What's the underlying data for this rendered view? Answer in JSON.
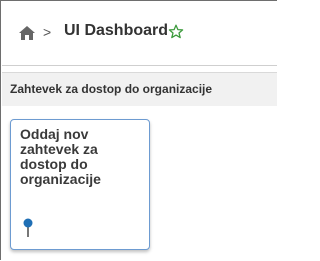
{
  "header": {
    "separator": ">",
    "title": "UI Dashboard",
    "home_icon": "home-icon",
    "favorite_icon": "star-outline-icon"
  },
  "section": {
    "title": "Zahtevek za dostop do organizacije"
  },
  "tiles": [
    {
      "label": "Oddaj nov zahtevek za dostop do organizacije",
      "icon": "pin-icon"
    }
  ],
  "colors": {
    "star": "#3c9a3c",
    "pin_head": "#1f6fb5",
    "tile_border": "#6d9bd1",
    "section_bg": "#f1f1f1"
  }
}
